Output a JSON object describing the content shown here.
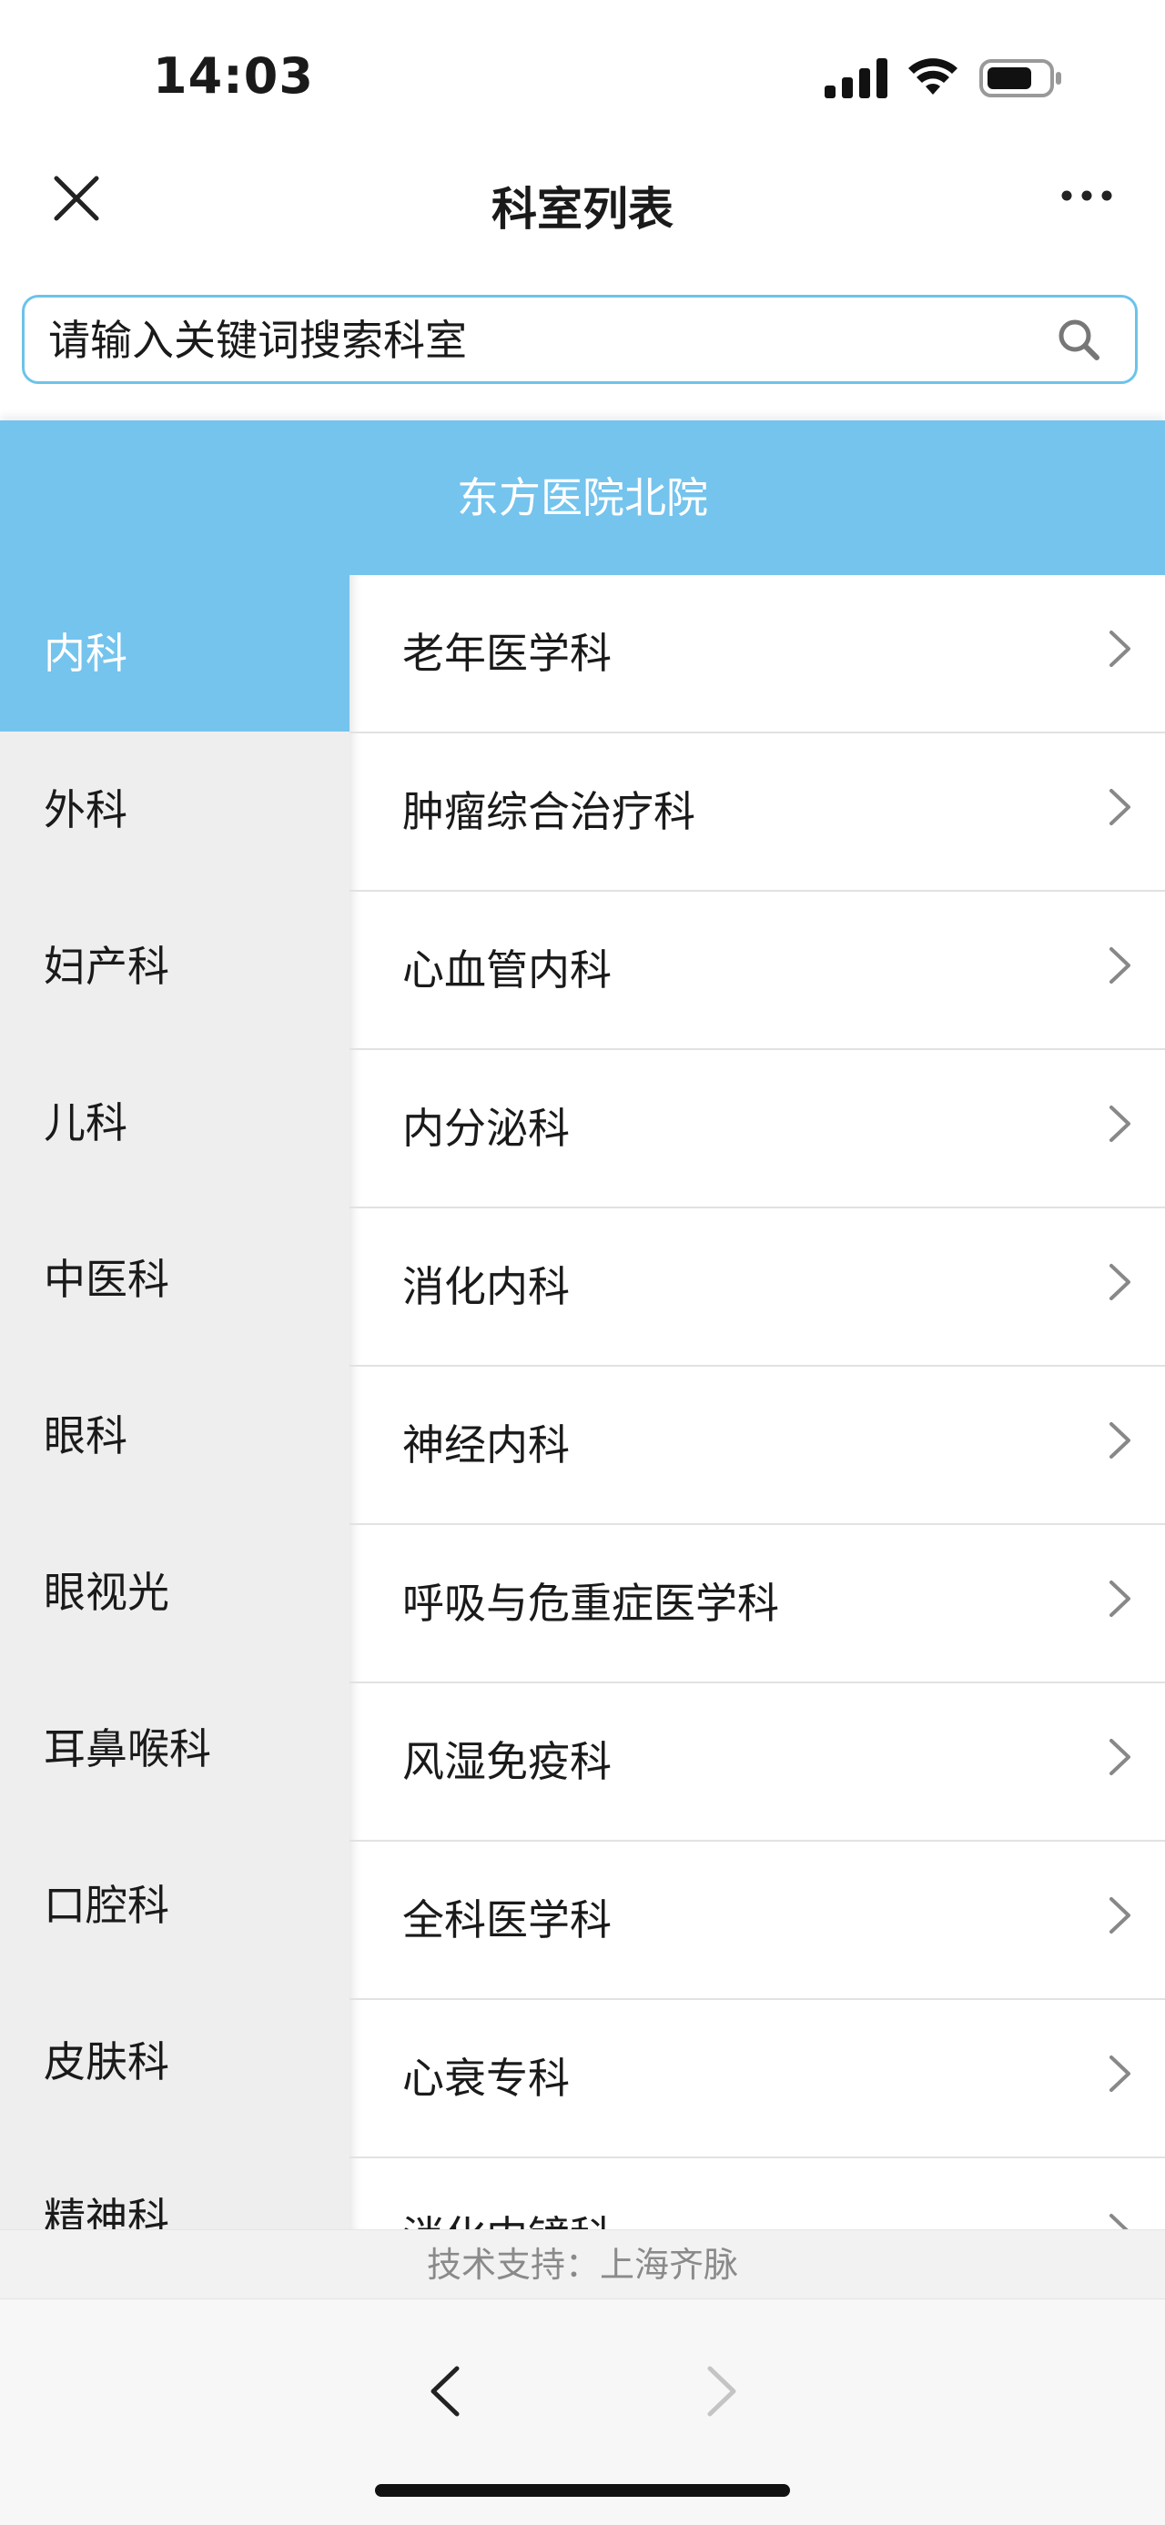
{
  "status_bar": {
    "time": "14:03"
  },
  "nav": {
    "title": "科室列表"
  },
  "search": {
    "placeholder": "请输入关键词搜索科室"
  },
  "hospital": {
    "name": "东方医院北院"
  },
  "sidebar": {
    "active_index": 0,
    "items": [
      "内科",
      "外科",
      "妇产科",
      "儿科",
      "中医科",
      "眼科",
      "眼视光",
      "耳鼻喉科",
      "口腔科",
      "皮肤科",
      "精神科"
    ]
  },
  "departments": [
    "老年医学科",
    "肿瘤综合治疗科",
    "心血管内科",
    "内分泌科",
    "消化内科",
    "神经内科",
    "呼吸与危重症医学科",
    "风湿免疫科",
    "全科医学科",
    "心衰专科",
    "消化内镜科"
  ],
  "footer": {
    "support": "技术支持：上海齐脉"
  },
  "colors": {
    "accent": "#74c4ee",
    "search_border": "#6cc3ea",
    "sidebar_bg": "#eeeeee"
  }
}
